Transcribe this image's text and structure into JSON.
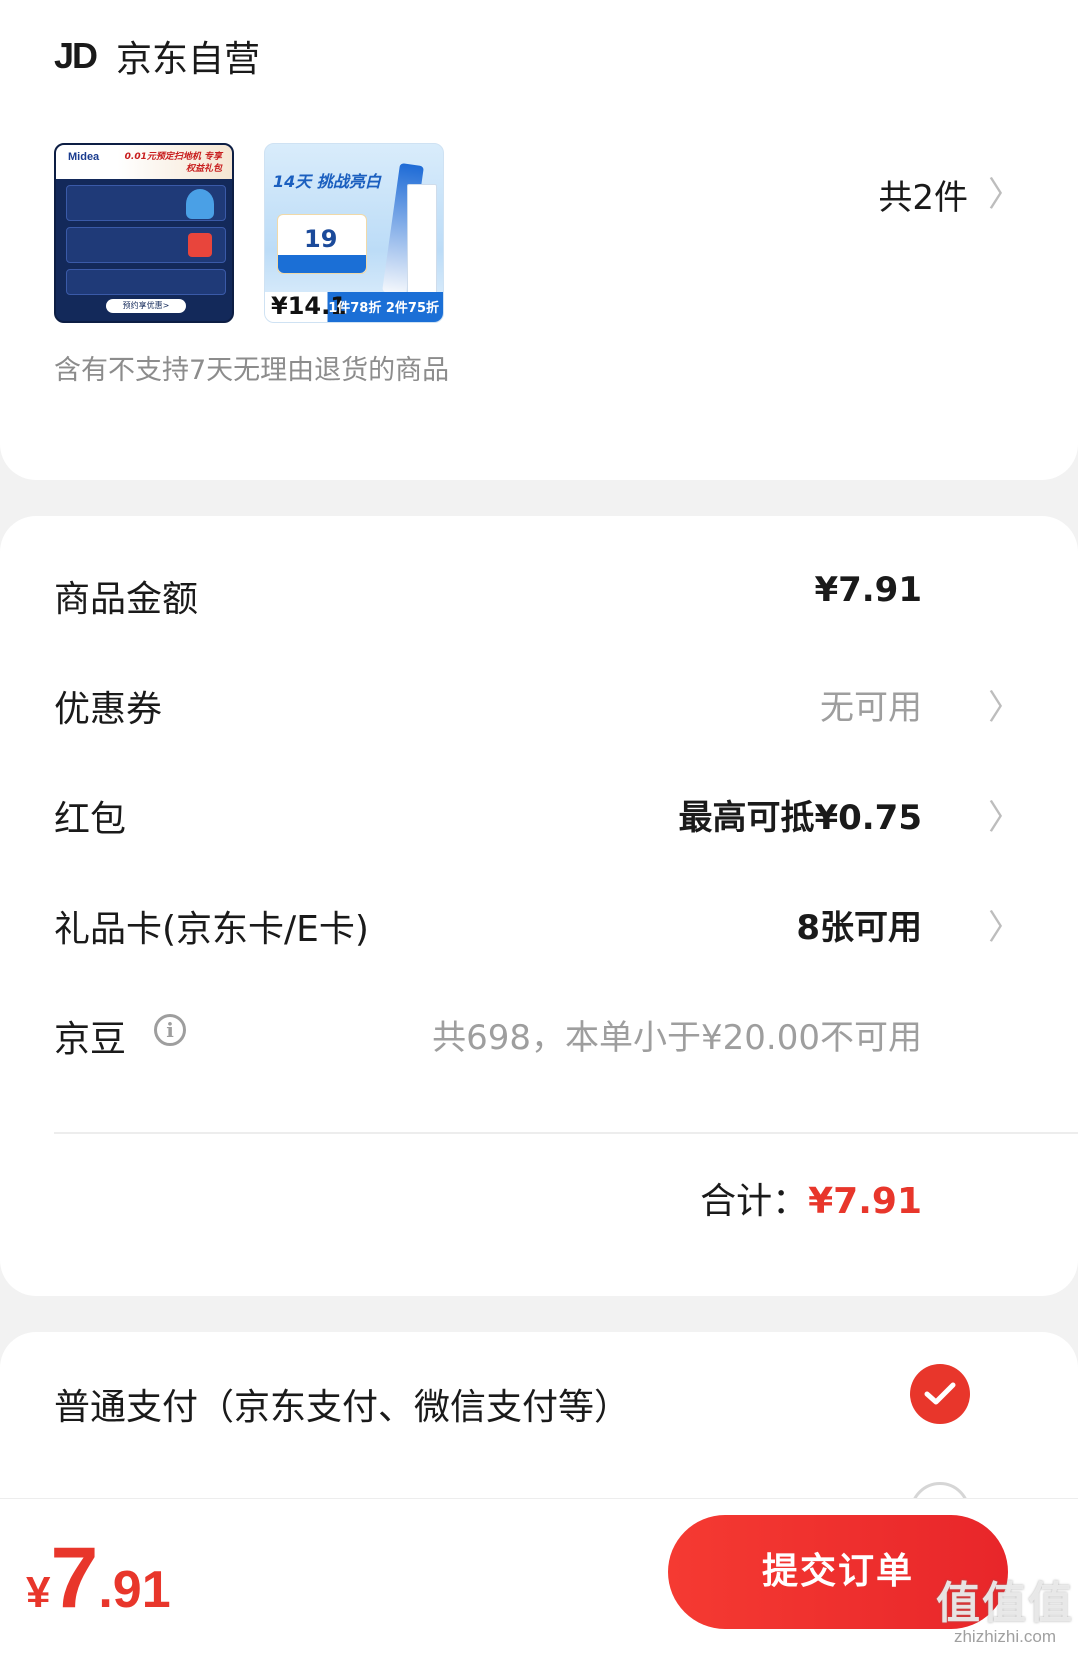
{
  "shop": {
    "logo_text": "JD",
    "name": "京东自营",
    "item_count": "共2件",
    "return_notice": "含有不支持7天无理由退货的商品",
    "thumbnails": [
      {
        "brand": "Midea",
        "promo": "0.01元预定扫地机 专享权益礼包",
        "button": "预约享优惠>"
      },
      {
        "headline": "14天 挑战亮白",
        "coupon": "19",
        "price": "¥14.1",
        "tag": "1件78折 2件75折"
      }
    ]
  },
  "price_details": {
    "rows": [
      {
        "label": "商品金额",
        "value": "¥7.91"
      },
      {
        "label": "优惠券",
        "value": "无可用"
      },
      {
        "label": "红包",
        "value": "最高可抵¥0.75"
      },
      {
        "label": "礼品卡(京东卡/E卡)",
        "value": "8张可用"
      },
      {
        "label": "京豆",
        "value": "共698，本单小于¥20.00不可用"
      }
    ],
    "total_label": "合计：",
    "total_value": "¥7.91"
  },
  "payment": {
    "option_1": "普通支付（京东支付、微信支付等）"
  },
  "bottom_bar": {
    "currency": "¥",
    "price_int": "7",
    "price_dec": ".91",
    "submit_label": "提交订单"
  },
  "watermark": {
    "big": "值值值",
    "small": "zhizhizhi.com"
  },
  "colors": {
    "accent": "#e8362b",
    "background": "#f2f2f2"
  }
}
